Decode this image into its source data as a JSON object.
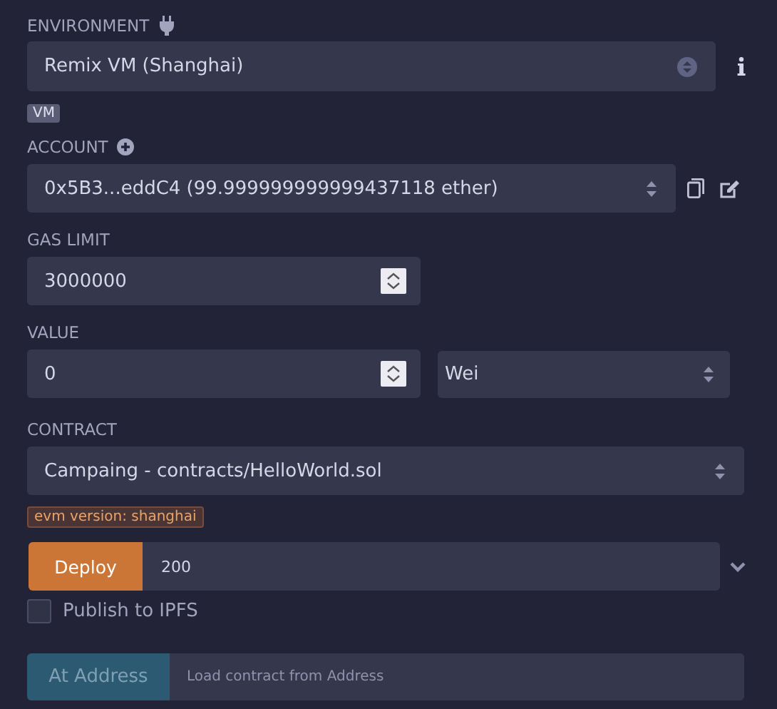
{
  "environment": {
    "label": "ENVIRONMENT",
    "value": "Remix VM (Shanghai)",
    "badge": "VM"
  },
  "account": {
    "label": "ACCOUNT",
    "value": "0x5B3...eddC4 (99.999999999999437118 ether)"
  },
  "gas_limit": {
    "label": "GAS LIMIT",
    "value": "3000000"
  },
  "value": {
    "label": "VALUE",
    "amount": "0",
    "unit": "Wei"
  },
  "contract": {
    "label": "CONTRACT",
    "value": "Campaing - contracts/HelloWorld.sol",
    "badge": "evm version: shanghai"
  },
  "deploy": {
    "button": "Deploy",
    "argument": "200"
  },
  "publish_ipfs": {
    "label": "Publish to IPFS",
    "checked": false
  },
  "at_address": {
    "button": "At Address",
    "placeholder": "Load contract from Address",
    "disabled": true
  }
}
